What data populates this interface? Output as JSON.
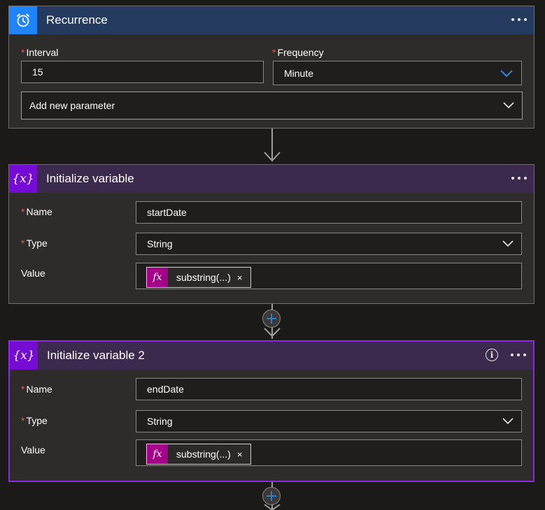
{
  "recurrence": {
    "title": "Recurrence",
    "header_color": "#243a5e",
    "icon_color": "#1f85ff",
    "interval_label": "Interval",
    "interval_value": "15",
    "frequency_label": "Frequency",
    "frequency_value": "Minute",
    "add_parameter_label": "Add new parameter"
  },
  "init_var_1": {
    "title": "Initialize variable",
    "header_color": "#3b2a4d",
    "icon_color": "#770bd6",
    "name_label": "Name",
    "name_value": "startDate",
    "type_label": "Type",
    "type_value": "String",
    "value_label": "Value",
    "token_label": "substring(...)",
    "token_remove": "×"
  },
  "init_var_2": {
    "title": "Initialize variable 2",
    "header_color": "#3b2a4d",
    "icon_color": "#770bd6",
    "name_label": "Name",
    "name_value": "endDate",
    "type_label": "Type",
    "type_value": "String",
    "value_label": "Value",
    "token_label": "substring(...)",
    "token_remove": "×"
  },
  "required_marker": "*",
  "info_glyph": "i",
  "fx_glyph": "fx",
  "var_icon_glyph": "{x}"
}
